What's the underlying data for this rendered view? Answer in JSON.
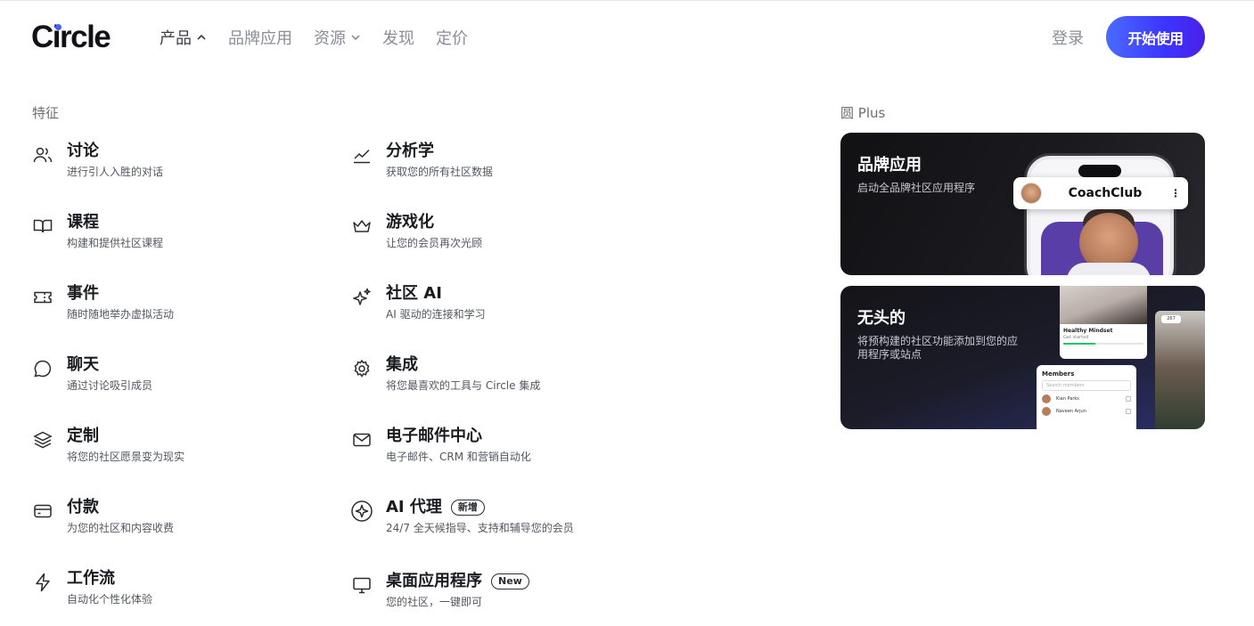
{
  "header": {
    "logo": "Circle",
    "nav": [
      {
        "label": "产品",
        "chevron": "up",
        "active": true
      },
      {
        "label": "品牌应用",
        "chevron": null,
        "active": false
      },
      {
        "label": "资源",
        "chevron": "down",
        "active": false
      },
      {
        "label": "发现",
        "chevron": null,
        "active": false
      },
      {
        "label": "定价",
        "chevron": null,
        "active": false
      }
    ],
    "login": "登录",
    "cta": "开始使用"
  },
  "features": {
    "label": "特征",
    "left": [
      {
        "icon": "users-icon",
        "title": "讨论",
        "desc": "进行引人入胜的对话"
      },
      {
        "icon": "book-open-icon",
        "title": "课程",
        "desc": "构建和提供社区课程"
      },
      {
        "icon": "ticket-icon",
        "title": "事件",
        "desc": "随时随地举办虚拟活动"
      },
      {
        "icon": "chat-bubble-icon",
        "title": "聊天",
        "desc": "通过讨论吸引成员"
      },
      {
        "icon": "layers-icon",
        "title": "定制",
        "desc": "将您的社区愿景变为现实"
      },
      {
        "icon": "credit-card-icon",
        "title": "付款",
        "desc": "为您的社区和内容收费"
      },
      {
        "icon": "lightning-icon",
        "title": "工作流",
        "desc": "自动化个性化体验"
      }
    ],
    "right": [
      {
        "icon": "line-chart-icon",
        "title": "分析学",
        "desc": "获取您的所有社区数据"
      },
      {
        "icon": "crown-icon",
        "title": "游戏化",
        "desc": "让您的会员再次光顾"
      },
      {
        "icon": "sparkles-icon",
        "title": "社区 AI",
        "desc": "AI 驱动的连接和学习"
      },
      {
        "icon": "gear-icon",
        "title": "集成",
        "desc": "将您最喜欢的工具与 Circle 集成"
      },
      {
        "icon": "mail-icon",
        "title": "电子邮件中心",
        "desc": "电子邮件、CRM 和营销自动化"
      },
      {
        "icon": "ai-agent-icon",
        "title": "AI 代理",
        "desc": "24/7 全天候指导、支持和辅导您的会员",
        "badge": "新增"
      },
      {
        "icon": "monitor-icon",
        "title": "桌面应用程序",
        "desc": "您的社区，一键即可",
        "badge": "New"
      }
    ]
  },
  "plus": {
    "label": "圆 Plus",
    "cards": [
      {
        "title": "品牌应用",
        "desc": "启动全品牌社区应用程序",
        "app_name": "CoachClub"
      },
      {
        "title": "无头的",
        "desc": "将预构建的社区功能添加到您的应用程序或站点",
        "mock": {
          "mini_title": "Healthy Mindset",
          "mini_sub": "Get started",
          "mini_progress": 0.4,
          "members_title": "Members",
          "search_placeholder": "Search members",
          "member_rows": [
            "Kian Parks",
            "Naveen Arjun"
          ],
          "chip": "267"
        }
      }
    ]
  },
  "colors": {
    "brand_dot": "#4262ff",
    "cta_gradient_start": "#4a6bff",
    "cta_gradient_end": "#4b20e8",
    "card_bg": "#161619",
    "purple_panel": "#5a3ea8"
  }
}
